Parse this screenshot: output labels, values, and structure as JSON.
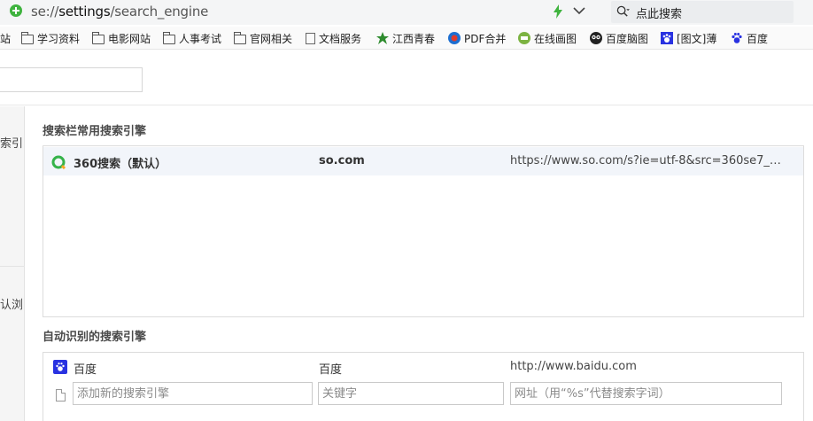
{
  "address_bar": {
    "url_scheme": "se://",
    "url_host": "settings",
    "url_path": "/search_engine",
    "search_placeholder": "点此搜索"
  },
  "bookmarks": [
    {
      "label": "站",
      "icon": "none"
    },
    {
      "label": "学习资料",
      "icon": "folder-icon"
    },
    {
      "label": "电影网站",
      "icon": "folder-icon"
    },
    {
      "label": "人事考试",
      "icon": "folder-icon"
    },
    {
      "label": "官网相关",
      "icon": "folder-icon"
    },
    {
      "label": "文档服务",
      "icon": "document-icon"
    },
    {
      "label": "江西青春",
      "icon": "green-leaf-icon"
    },
    {
      "label": "PDF合并",
      "icon": "pdf-icon"
    },
    {
      "label": "在线画图",
      "icon": "draw-icon"
    },
    {
      "label": "百度脑图",
      "icon": "owl-icon"
    },
    {
      "label": "[图文]薄",
      "icon": "baidu-paw-icon"
    },
    {
      "label": "百度",
      "icon": "baidu-paw-blue-icon"
    }
  ],
  "sidebar": {
    "item1": "索引",
    "item2": "认浏"
  },
  "common_section": {
    "title": "搜索栏常用搜索引擎",
    "engines": [
      {
        "name": "360搜索（默认）",
        "keyword": "so.com",
        "url": "https://www.so.com/s?ie=utf-8&src=360se7_a..."
      }
    ]
  },
  "auto_section": {
    "title": "自动识别的搜索引擎",
    "engines": [
      {
        "name": "百度",
        "keyword": "百度",
        "url": "http://www.baidu.com"
      }
    ],
    "add_row": {
      "name_placeholder": "添加新的搜索引擎",
      "keyword_placeholder": "关键字",
      "url_placeholder": "网址（用“%s”代替搜索字词）"
    }
  },
  "colors": {
    "accent_green": "#3fb33f",
    "baidu_blue": "#2932e1",
    "selected_row": "#f2f5fa"
  }
}
